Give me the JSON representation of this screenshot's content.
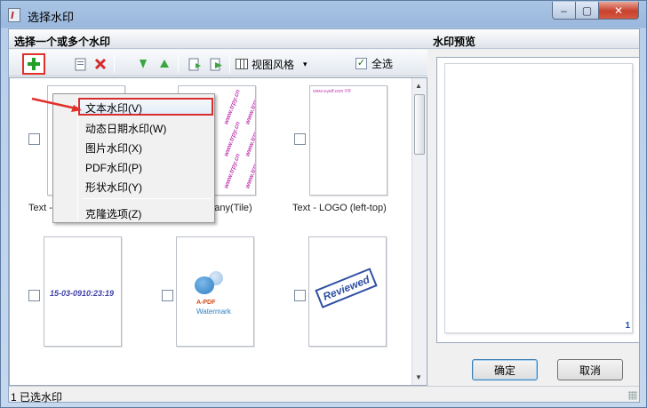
{
  "window": {
    "title": "选择水印",
    "controls": {
      "minimize": "–",
      "maximize": "▢",
      "close": "✕"
    }
  },
  "left_panel": {
    "heading": "选择一个或多个水印"
  },
  "right_panel": {
    "heading": "水印预览",
    "page_number": "1"
  },
  "toolbar": {
    "view_style_label": "视图风格",
    "view_style_dropdown": "▾",
    "select_all_label": "全选",
    "select_all_checked": true,
    "checkmark": "✓"
  },
  "context_menu": {
    "items": [
      "文本水印(V)",
      "动态日期水印(W)",
      "图片水印(X)",
      "PDF水印(P)",
      "形状水印(Y)"
    ],
    "clone_option": "克隆选项(Z)"
  },
  "watermarks": [
    {
      "label": "Text - CONFIDENTIAL",
      "kind": "confidential"
    },
    {
      "label": "Text - Company(Tile)",
      "kind": "tile",
      "tile_text": "www.trpy.cn"
    },
    {
      "label": "Text - LOGO (left-top)",
      "kind": "logo",
      "corner_text": "www.a-pdf.com ©®"
    },
    {
      "label": "",
      "kind": "date",
      "date_text": "15-03-0910:23:19"
    },
    {
      "label": "",
      "kind": "image",
      "logo_line1": "A-PDF",
      "logo_line2": "Watermark"
    },
    {
      "label": "",
      "kind": "stamp",
      "stamp_text": "Reviewed"
    }
  ],
  "buttons": {
    "ok": "确定",
    "cancel": "取消"
  },
  "status": {
    "text": "1 已选水印"
  },
  "colors": {
    "highlight_border": "#d92d2d",
    "tile_text": "#c13bb6",
    "stamp": "#3050a4"
  }
}
